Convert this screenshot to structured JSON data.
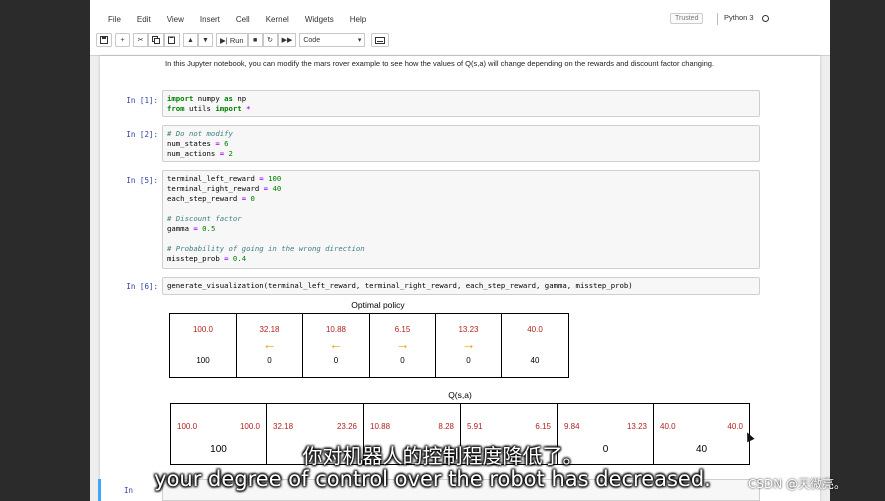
{
  "menu": [
    "File",
    "Edit",
    "View",
    "Insert",
    "Cell",
    "Kernel",
    "Widgets",
    "Help"
  ],
  "trusted": "Trusted",
  "kernel": "Python 3",
  "toolbar": {
    "run": "Run",
    "cell_type": "Code",
    "dropdown_arrow": "▾"
  },
  "intro": "In this Jupyter notebook, you can modify the mars rover example to see how the values of Q(s,a) will change depending on the rewards and discount factor changing.",
  "cells": [
    {
      "prompt": "In [1]:"
    },
    {
      "prompt": "In [2]:"
    },
    {
      "prompt": "In [5]:"
    },
    {
      "prompt": "In [6]:"
    }
  ],
  "code": {
    "c1_l1_kw": "import",
    "c1_l1_mid": " numpy ",
    "c1_l1_kw2": "as",
    "c1_l1_end": " np",
    "c1_l2_kw": "from",
    "c1_l2_mid": " utils ",
    "c1_l2_kw2": "import",
    "c1_l2_end": " *",
    "c2_comment": "# Do not modify",
    "c2_l2_a": "num_states ",
    "c2_l2_op": "=",
    "c2_l2_v": " 6",
    "c2_l3_a": "num_actions ",
    "c2_l3_op": "=",
    "c2_l3_v": " 2",
    "c3_l1_a": "terminal_left_reward ",
    "c3_l1_v": " 100",
    "c3_l2_a": "terminal_right_reward ",
    "c3_l2_v": " 40",
    "c3_l3_a": "each_step_reward ",
    "c3_l3_v": " 0",
    "c3_cm1": "# Discount factor",
    "c3_l5_a": "gamma ",
    "c3_l5_v": " 0.5",
    "c3_cm2": "# Probability of going in the wrong direction",
    "c3_l7_a": "misstep_prob ",
    "c3_l7_v": " 0.4",
    "eq": "=",
    "c4": "generate_visualization(terminal_left_reward, terminal_right_reward, each_step_reward, gamma, misstep_prob)"
  },
  "policy": {
    "title": "Optimal policy",
    "cells": [
      {
        "reward": "100.0",
        "arrow": "",
        "value": "100"
      },
      {
        "reward": "32.18",
        "arrow": "←",
        "value": "0"
      },
      {
        "reward": "10.88",
        "arrow": "←",
        "value": "0"
      },
      {
        "reward": "6.15",
        "arrow": "→",
        "value": "0"
      },
      {
        "reward": "13.23",
        "arrow": "→",
        "value": "0"
      },
      {
        "reward": "40.0",
        "arrow": "",
        "value": "40"
      }
    ]
  },
  "qsa": {
    "title": "Q(s,a)",
    "cells": [
      {
        "left": "100.0",
        "right": "100.0",
        "value": "100"
      },
      {
        "left": "32.18",
        "right": "23.26",
        "value": ""
      },
      {
        "left": "10.88",
        "right": "8.28",
        "value": ""
      },
      {
        "left": "5.91",
        "right": "6.15",
        "value": ""
      },
      {
        "left": "9.84",
        "right": "13.23",
        "value": "0"
      },
      {
        "left": "40.0",
        "right": "40.0",
        "value": "40"
      }
    ]
  },
  "next_prompt": "In",
  "subtitles": {
    "cn": "你对机器人的控制程度降低了。",
    "en": "your degree of control over the robot has decreased."
  },
  "watermark": "CSDN @天微亮。"
}
